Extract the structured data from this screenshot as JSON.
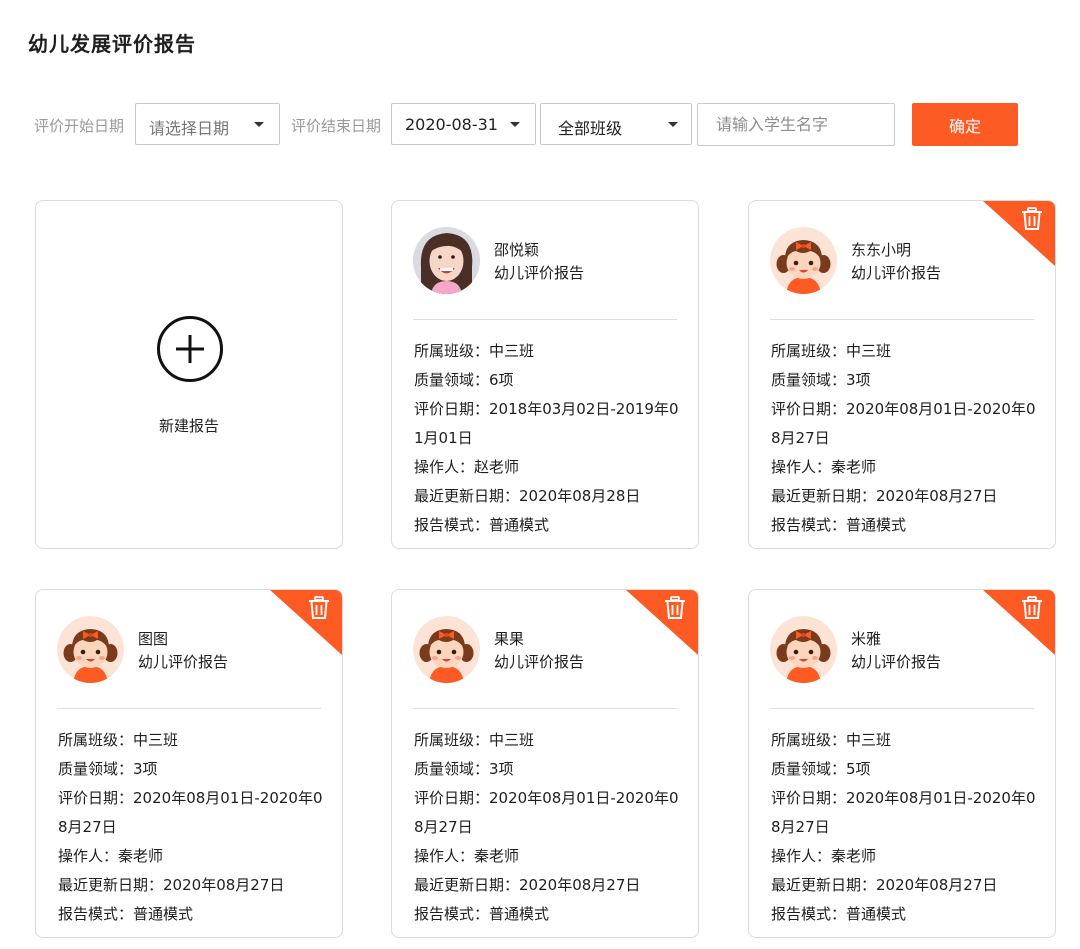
{
  "page_title": "幼儿发展评价报告",
  "filters": {
    "start_label": "评价开始日期",
    "start_placeholder": "请选择日期",
    "end_label": "评价结束日期",
    "end_value": "2020-08-31",
    "class_value": "全部班级",
    "name_placeholder": "请输入学生名字",
    "confirm_label": "确定"
  },
  "new_report_label": "新建报告",
  "field_labels": {
    "class": "所属班级：",
    "domains": "质量领域：",
    "period": "评价日期：",
    "operator": "操作人：",
    "updated": "最近更新日期：",
    "mode": "报告模式："
  },
  "cards": [
    {
      "name": "邵悦颖",
      "subtitle": "幼儿评价报告",
      "avatar": "photo-avatar",
      "class": "中三班",
      "domains": "6项",
      "period": "2018年03月02日-2019年01月01日",
      "operator": "赵老师",
      "updated": "2020年08月28日",
      "mode": "普通模式",
      "deletable": false
    },
    {
      "name": "东东小明",
      "subtitle": "幼儿评价报告",
      "avatar": "cartoon-girl-avatar",
      "class": "中三班",
      "domains": "3项",
      "period": "2020年08月01日-2020年08月27日",
      "operator": "秦老师",
      "updated": "2020年08月27日",
      "mode": "普通模式",
      "deletable": true
    },
    {
      "name": "图图",
      "subtitle": "幼儿评价报告",
      "avatar": "cartoon-girl-avatar",
      "class": "中三班",
      "domains": "3项",
      "period": "2020年08月01日-2020年08月27日",
      "operator": "秦老师",
      "updated": "2020年08月27日",
      "mode": "普通模式",
      "deletable": true
    },
    {
      "name": "果果",
      "subtitle": "幼儿评价报告",
      "avatar": "cartoon-girl-avatar",
      "class": "中三班",
      "domains": "3项",
      "period": "2020年08月01日-2020年08月27日",
      "operator": "秦老师",
      "updated": "2020年08月27日",
      "mode": "普通模式",
      "deletable": true
    },
    {
      "name": "米雅",
      "subtitle": "幼儿评价报告",
      "avatar": "cartoon-girl-avatar",
      "class": "中三班",
      "domains": "5项",
      "period": "2020年08月01日-2020年08月27日",
      "operator": "秦老师",
      "updated": "2020年08月27日",
      "mode": "普通模式",
      "deletable": true
    }
  ],
  "colors": {
    "accent": "#fe5b24",
    "border": "#dcdcdc",
    "label_gray": "#9a9a9a"
  }
}
